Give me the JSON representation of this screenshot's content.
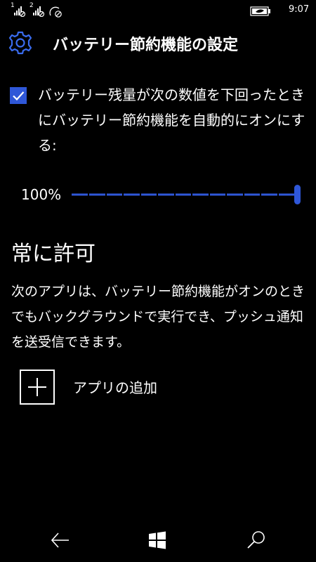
{
  "status": {
    "sim1_label": "1",
    "sim2_label": "2",
    "time": "9:07",
    "icons": [
      "signal-sim1-icon",
      "signal-sim2-icon",
      "no-network-icon",
      "battery-saver-icon"
    ]
  },
  "header": {
    "title": "バッテリー節約機能の設定",
    "icon": "gear-icon"
  },
  "auto_on": {
    "checked": true,
    "label": "バッテリー残量が次の数値を下回ったときにバッテリー節約機能を自動的にオンにする:"
  },
  "slider": {
    "value_text": "100%",
    "value": 1.0
  },
  "always_allowed": {
    "title": "常に許可",
    "description": "次のアプリは、バッテリー節約機能がオンのときでもバックグラウンドで実行でき、プッシュ通知を送受信できます。",
    "add_label": "アプリの追加"
  },
  "nav": {
    "icons": [
      "back-icon",
      "windows-start-icon",
      "search-icon"
    ]
  },
  "colors": {
    "accent": "#2f57d8",
    "background": "#000000",
    "text": "#ffffff"
  }
}
